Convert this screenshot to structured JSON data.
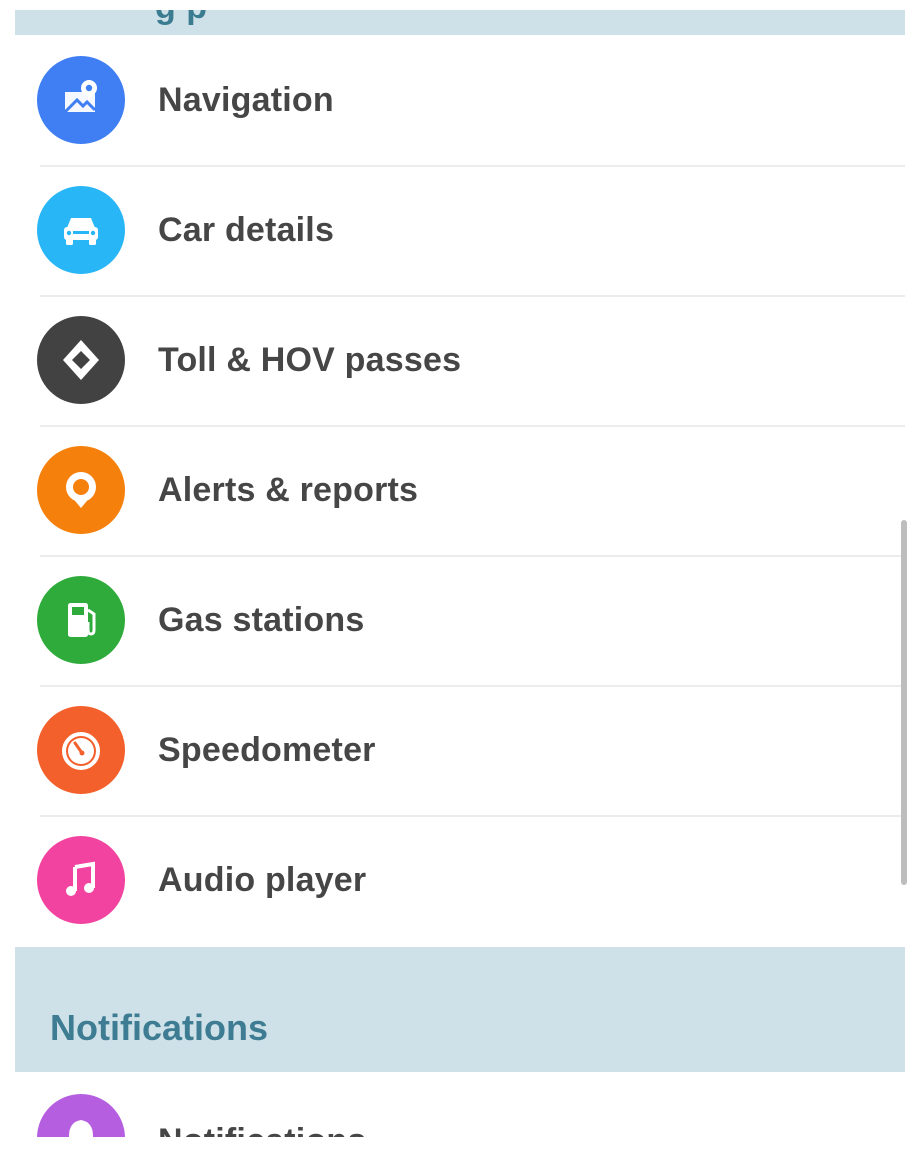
{
  "top_section": {
    "title_fragment": "g p"
  },
  "items": [
    {
      "label": "Navigation",
      "icon": "map-pin-icon",
      "color": "#3f7ef3"
    },
    {
      "label": "Car details",
      "icon": "car-icon",
      "color": "#29b6f6"
    },
    {
      "label": "Toll & HOV passes",
      "icon": "diamond-icon",
      "color": "#424242"
    },
    {
      "label": "Alerts & reports",
      "icon": "alert-pin-icon",
      "color": "#f6800c"
    },
    {
      "label": "Gas stations",
      "icon": "gas-pump-icon",
      "color": "#2eab3a"
    },
    {
      "label": "Speedometer",
      "icon": "speedometer-icon",
      "color": "#f4602c"
    },
    {
      "label": "Audio player",
      "icon": "music-note-icon",
      "color": "#f243a0"
    }
  ],
  "notifications_section": {
    "title": "Notifications"
  },
  "partial_item": {
    "label": "Notifications",
    "icon": "bell-icon",
    "color": "#b65ee0"
  },
  "colors": {
    "section_background": "#cfe1e8",
    "section_title": "#3d7c92",
    "label_text": "#464646",
    "divider": "#ececec"
  }
}
